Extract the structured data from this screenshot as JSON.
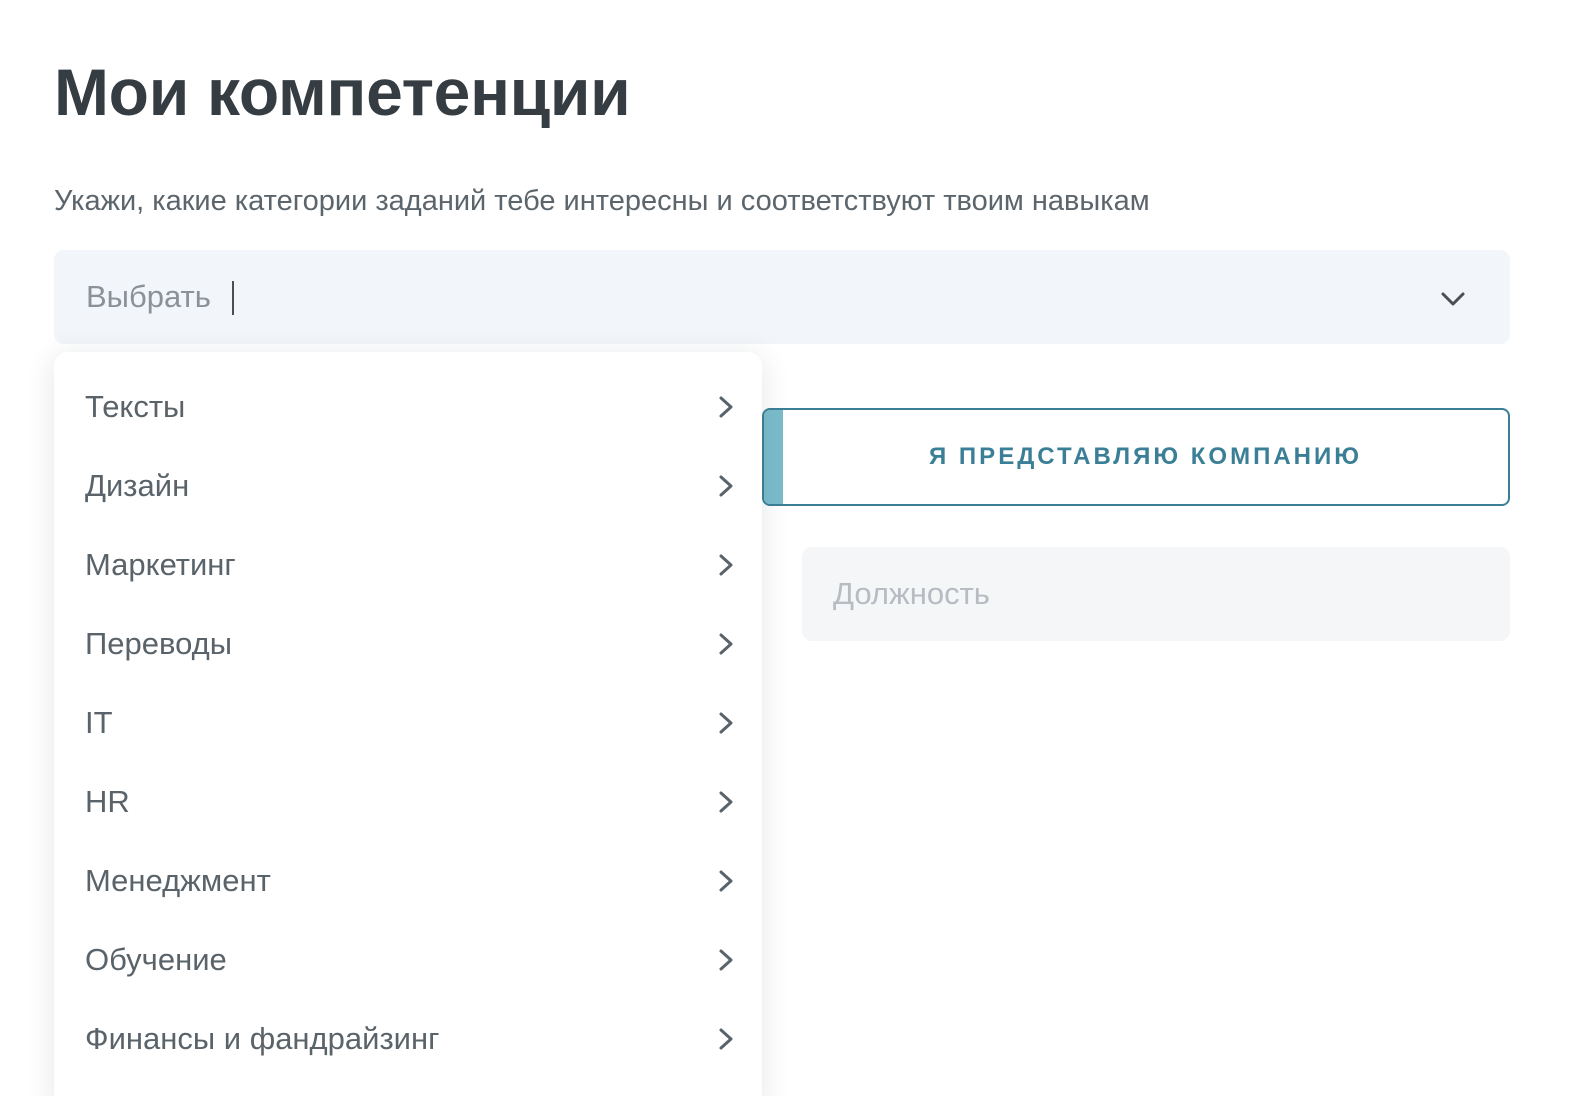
{
  "page": {
    "title": "Мои компетенции",
    "subtitle": "Укажи, какие категории заданий тебе интересны и соответствуют твоим навыкам"
  },
  "select": {
    "placeholder": "Выбрать",
    "icon": "chevron-down-icon",
    "expanded": true
  },
  "dropdown": {
    "items": [
      {
        "label": "Тексты",
        "icon": "chevron-right-icon"
      },
      {
        "label": "Дизайн",
        "icon": "chevron-right-icon"
      },
      {
        "label": "Маркетинг",
        "icon": "chevron-right-icon"
      },
      {
        "label": "Переводы",
        "icon": "chevron-right-icon"
      },
      {
        "label": "IT",
        "icon": "chevron-right-icon"
      },
      {
        "label": "HR",
        "icon": "chevron-right-icon"
      },
      {
        "label": "Менеджмент",
        "icon": "chevron-right-icon"
      },
      {
        "label": "Обучение",
        "icon": "chevron-right-icon"
      },
      {
        "label": "Финансы и фандрайзинг",
        "icon": "chevron-right-icon"
      }
    ]
  },
  "company": {
    "button_label": "Я ПРЕДСТАВЛЯЮ КОМПАНИЮ",
    "position_placeholder": "Должность"
  },
  "colors": {
    "heading": "#353d42",
    "text": "#5a6369",
    "field_bg": "#f2f5f9",
    "accent": "#3b7f97",
    "accent_light": "#7bbccb"
  }
}
